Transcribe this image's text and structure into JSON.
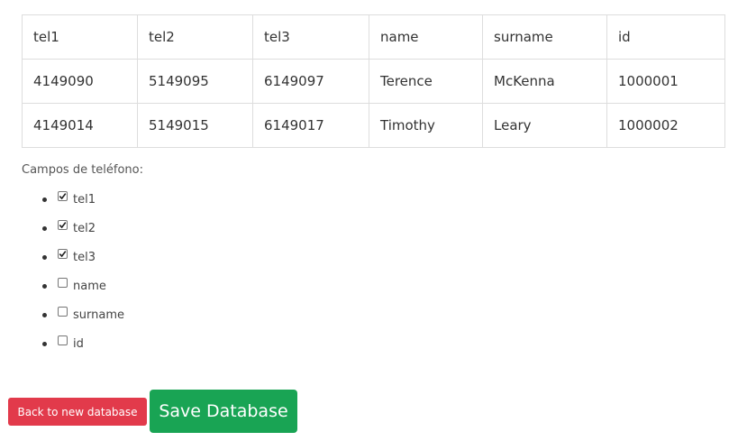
{
  "table": {
    "headers": [
      "tel1",
      "tel2",
      "tel3",
      "name",
      "surname",
      "id"
    ],
    "rows": [
      [
        "4149090",
        "5149095",
        "6149097",
        "Terence",
        "McKenna",
        "1000001"
      ],
      [
        "4149014",
        "5149015",
        "6149017",
        "Timothy",
        "Leary",
        "1000002"
      ]
    ]
  },
  "phone_fields": {
    "label": "Campos de teléfono:",
    "options": [
      {
        "label": "tel1",
        "checked": true
      },
      {
        "label": "tel2",
        "checked": true
      },
      {
        "label": "tel3",
        "checked": true
      },
      {
        "label": "name",
        "checked": false
      },
      {
        "label": "surname",
        "checked": false
      },
      {
        "label": "id",
        "checked": false
      }
    ]
  },
  "buttons": {
    "back_label": "Back to new database",
    "save_label": "Save Database"
  },
  "colors": {
    "back_button": "#e23a4b",
    "save_button": "#19a454",
    "table_border": "#dddddd"
  }
}
